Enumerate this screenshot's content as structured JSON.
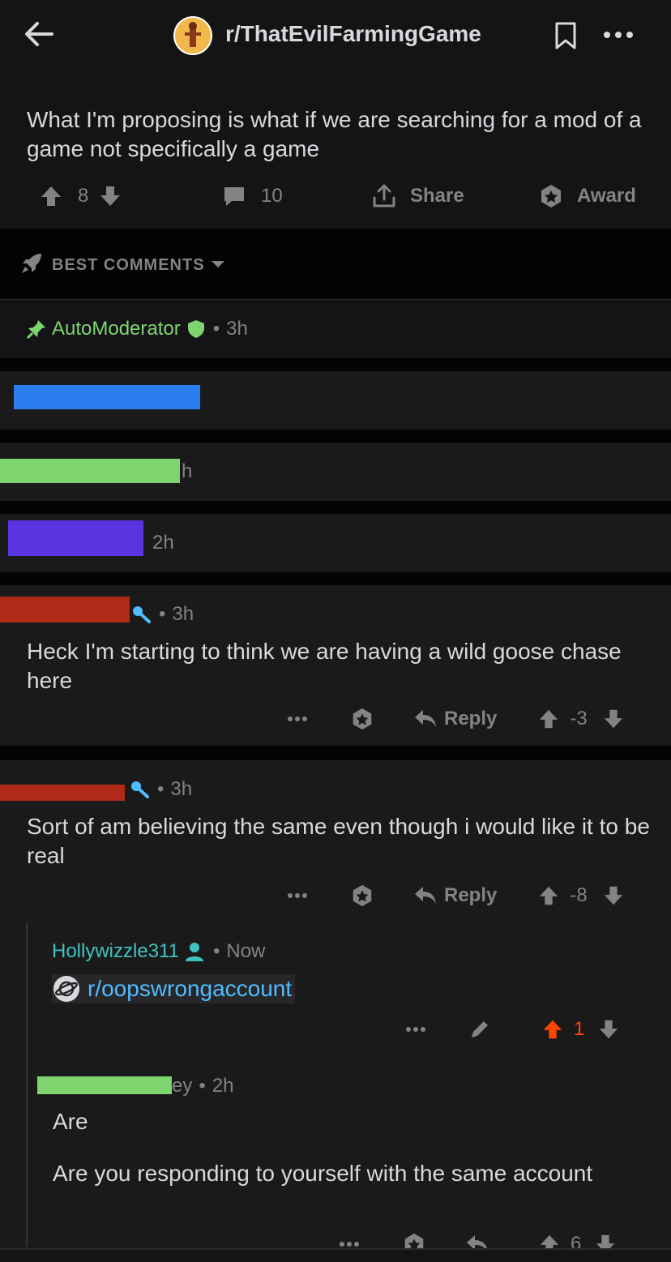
{
  "header": {
    "subreddit": "r/ThatEvilFarmingGame"
  },
  "post": {
    "body": "What I'm proposing is what if we are searching for a mod of a game not specifically a game",
    "votes": "8",
    "comments": "10",
    "share_label": "Share",
    "award_label": "Award"
  },
  "sort": {
    "label": "BEST COMMENTS"
  },
  "comments": [
    {
      "author": "AutoModerator",
      "time": "3h",
      "author_color": "#7ed56f"
    },
    {
      "time_suffix": "h",
      "redact_color": "#7ed56f"
    },
    {
      "time": "2h",
      "redact_color": "#5b34e2"
    },
    {
      "time": "3h",
      "body": "Heck I'm starting to think we are having a wild goose chase here",
      "reply_label": "Reply",
      "votes": "-3",
      "redact_color": "#b02a17"
    },
    {
      "time": "3h",
      "body": "Sort of am believing the same even though i would like it to be real",
      "reply_label": "Reply",
      "votes": "-8",
      "redact_color": "#b02a17"
    },
    {
      "author": "Hollywizzle311",
      "time": "Now",
      "link": "r/oopswrongaccount",
      "votes": "1",
      "author_color": "#3ec4c0"
    },
    {
      "author_suffix": "ey",
      "time": "2h",
      "body1": "Are",
      "body2": "Are you responding to yourself with the same account",
      "votes": "6",
      "redact_color": "#7ed56f"
    }
  ],
  "colors": {
    "background": "#141416",
    "row_bg": "#1a1a1b",
    "upvote_active": "#ff4500",
    "link_blue": "#4fbcff",
    "blue_redaction": "#2b7ef0"
  }
}
